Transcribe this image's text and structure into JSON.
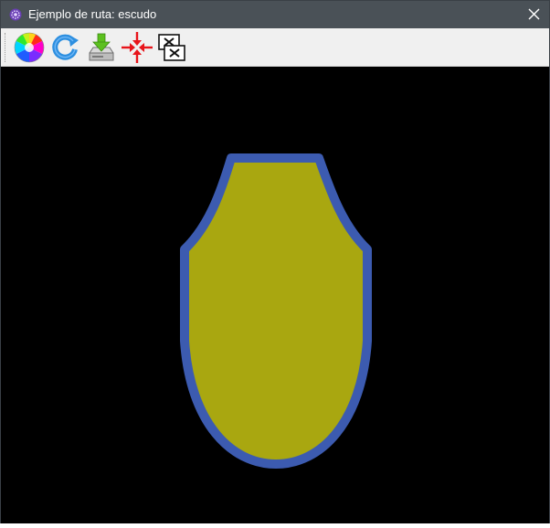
{
  "window": {
    "title": "Ejemplo de ruta: escudo"
  },
  "titlebar": {
    "app_icon": "app-gear-icon",
    "close_icon": "close-icon"
  },
  "toolbar": {
    "items": [
      {
        "icon": "color-wheel-icon"
      },
      {
        "icon": "refresh-icon"
      },
      {
        "icon": "save-download-icon"
      },
      {
        "icon": "collapse-arrows-icon"
      },
      {
        "icon": "close-windows-icon"
      }
    ]
  },
  "canvas": {
    "background": "#000000",
    "shape": "escudo",
    "fill_color": "#a9a710",
    "stroke_color": "#3c5bb0"
  },
  "colors": {
    "titlebar": "#4a5157",
    "toolbar": "#f0f0f0",
    "accent_red": "#e8141a",
    "accent_blue": "#2d8fe0",
    "accent_green": "#5cc01f"
  }
}
